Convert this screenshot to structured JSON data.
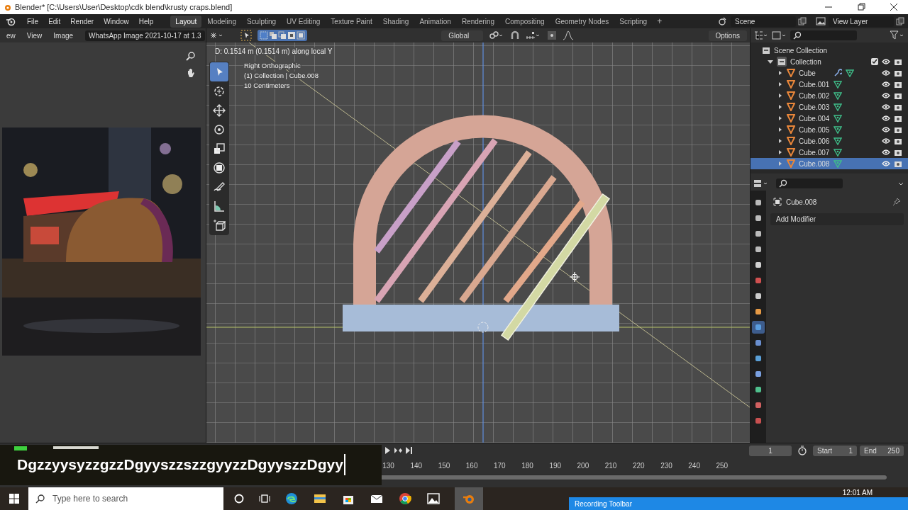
{
  "window": {
    "title": "Blender* [C:\\Users\\User\\Desktop\\cdk blend\\krusty craps.blend]"
  },
  "menu": [
    "File",
    "Edit",
    "Render",
    "Window",
    "Help"
  ],
  "workspaces": [
    {
      "label": "Layout",
      "selected": true
    },
    {
      "label": "Modeling",
      "selected": false
    },
    {
      "label": "Sculpting",
      "selected": false
    },
    {
      "label": "UV Editing",
      "selected": false
    },
    {
      "label": "Texture Paint",
      "selected": false
    },
    {
      "label": "Shading",
      "selected": false
    },
    {
      "label": "Animation",
      "selected": false
    },
    {
      "label": "Rendering",
      "selected": false
    },
    {
      "label": "Compositing",
      "selected": false
    },
    {
      "label": "Geometry Nodes",
      "selected": false
    },
    {
      "label": "Scripting",
      "selected": false
    }
  ],
  "add_workspace": "+",
  "scene": "Scene",
  "view_layer": "View Layer",
  "image_editor": {
    "menus": [
      "ew",
      "View",
      "Image"
    ],
    "image_name": "WhatsApp Image 2021-10-17 at 1.3"
  },
  "viewport": {
    "orientation": "Global",
    "options": "Options",
    "status": "D: 0.1514 m (0.1514 m) along local Y",
    "info": [
      "Right Orthographic",
      "(1) Collection | Cube.008",
      "10 Centimeters"
    ],
    "tools": [
      {
        "kind": "select",
        "selected": true
      },
      {
        "kind": "cursor",
        "selected": false
      },
      {
        "kind": "move",
        "selected": false
      },
      {
        "kind": "rotate",
        "selected": false
      },
      {
        "kind": "scale",
        "selected": false
      },
      {
        "kind": "transform",
        "selected": false
      },
      {
        "kind": "annotate",
        "selected": false
      },
      {
        "kind": "measure",
        "selected": false
      },
      {
        "kind": "add_cube",
        "selected": false
      }
    ]
  },
  "outliner": {
    "root": "Scene Collection",
    "collection": {
      "label": "Collection",
      "expanded": true,
      "checked": true,
      "children": [
        {
          "label": "Cube",
          "selected": false,
          "modifier": true
        },
        {
          "label": "Cube.001",
          "selected": false,
          "modifier": false
        },
        {
          "label": "Cube.002",
          "selected": false,
          "modifier": false
        },
        {
          "label": "Cube.003",
          "selected": false,
          "modifier": false
        },
        {
          "label": "Cube.004",
          "selected": false,
          "modifier": false
        },
        {
          "label": "Cube.005",
          "selected": false,
          "modifier": false
        },
        {
          "label": "Cube.006",
          "selected": false,
          "modifier": false
        },
        {
          "label": "Cube.007",
          "selected": false,
          "modifier": false
        },
        {
          "label": "Cube.008",
          "selected": true,
          "modifier": false
        }
      ]
    }
  },
  "properties": {
    "object": "Cube.008",
    "add_modifier": "Add Modifier",
    "tabs": [
      {
        "kind": "tool",
        "selected": false
      },
      {
        "kind": "render",
        "selected": false
      },
      {
        "kind": "output",
        "selected": false
      },
      {
        "kind": "view_layer",
        "selected": false
      },
      {
        "kind": "scene",
        "selected": false
      },
      {
        "kind": "world",
        "selected": false
      },
      {
        "kind": "collection",
        "selected": false
      },
      {
        "kind": "object",
        "selected": false
      },
      {
        "kind": "modifier",
        "selected": true
      },
      {
        "kind": "particles",
        "selected": false
      },
      {
        "kind": "physics",
        "selected": false
      },
      {
        "kind": "constraints",
        "selected": false
      },
      {
        "kind": "data",
        "selected": false
      },
      {
        "kind": "material",
        "selected": false
      },
      {
        "kind": "texture",
        "selected": false
      }
    ]
  },
  "timeline": {
    "frame": "1",
    "start_label": "Start",
    "start": "1",
    "end_label": "End",
    "end": "250",
    "ticks": [
      "130",
      "140",
      "150",
      "160",
      "170",
      "180",
      "190",
      "200",
      "210",
      "220",
      "230",
      "240",
      "250"
    ]
  },
  "caption": "DgzzyysyzzgzzDgyyszzszzgyyzzDgyyszzDgyy",
  "taskbar": {
    "search_placeholder": "Type here to search",
    "clock": "12:01 AM"
  },
  "recording_toolbar": {
    "title": "Recording Toolbar"
  }
}
